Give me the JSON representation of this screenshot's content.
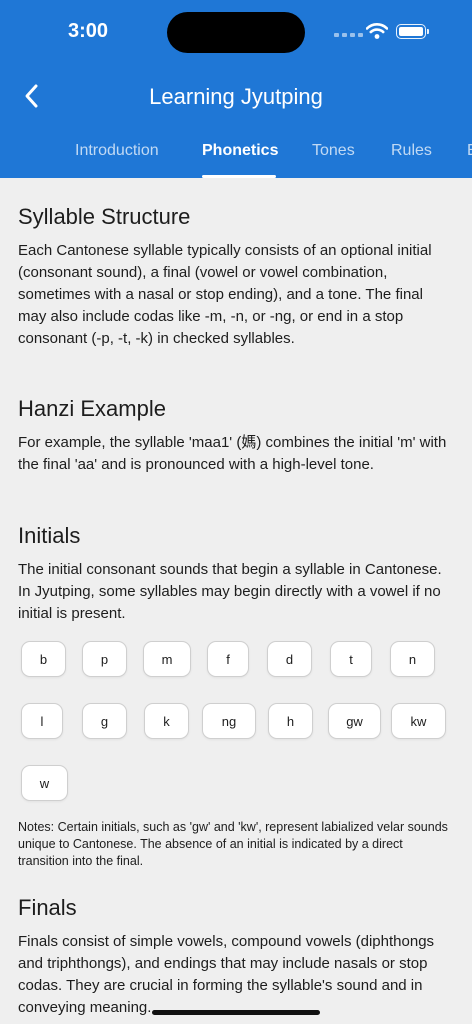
{
  "status_bar": {
    "time": "3:00"
  },
  "nav": {
    "title": "Learning Jyutping",
    "back_icon": "chevron-left-icon"
  },
  "tabs": [
    {
      "label": "Introduction",
      "active": false
    },
    {
      "label": "Phonetics",
      "active": true
    },
    {
      "label": "Tones",
      "active": false
    },
    {
      "label": "Rules",
      "active": false
    },
    {
      "label": "E",
      "active": false
    }
  ],
  "sections": {
    "syllable": {
      "heading": "Syllable Structure",
      "body": "Each Cantonese syllable typically consists of an optional initial (consonant sound), a final (vowel or vowel combination, sometimes with a nasal or stop ending), and a tone. The final may also include codas like -m, -n, or -ng, or end in a stop consonant (-p, -t, -k) in checked syllables."
    },
    "hanzi": {
      "heading": "Hanzi Example",
      "body": "For example, the syllable 'maa1' (媽) combines the initial 'm' with the final 'aa' and is pronounced with a high-level tone."
    },
    "initials": {
      "heading": "Initials",
      "body": "The initial consonant sounds that begin a syllable in Cantonese. In Jyutping, some syllables may begin directly with a vowel if no initial is present.",
      "chips": [
        "b",
        "p",
        "m",
        "f",
        "d",
        "t",
        "n",
        "l",
        "g",
        "k",
        "ng",
        "h",
        "gw",
        "kw",
        "w"
      ],
      "notes": "Notes: Certain initials, such as 'gw' and 'kw', represent labialized velar sounds unique to Cantonese. The absence of an initial is indicated by a direct transition into the final."
    },
    "finals": {
      "heading": "Finals",
      "body": "Finals consist of simple vowels, compound vowels (diphthongs and triphthongs), and endings that may include nasals or stop codas. They are crucial in forming the syllable's sound and in conveying meaning."
    }
  },
  "colors": {
    "accent": "#1f77d6",
    "background": "#efefef"
  }
}
